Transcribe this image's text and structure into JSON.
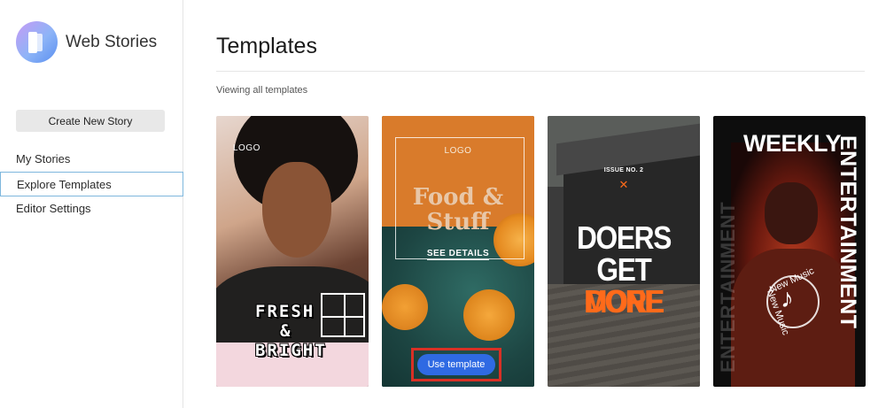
{
  "app": {
    "name": "Web Stories"
  },
  "sidebar": {
    "create_button": "Create New Story",
    "nav": [
      {
        "label": "My Stories",
        "active": false
      },
      {
        "label": "Explore Templates",
        "active": true
      },
      {
        "label": "Editor Settings",
        "active": false
      }
    ]
  },
  "main": {
    "title": "Templates",
    "subtitle": "Viewing all templates"
  },
  "templates": [
    {
      "logo": "LOGO",
      "lines": [
        "FRESH",
        "&",
        "BRIGHT"
      ]
    },
    {
      "logo": "LOGO",
      "lines": [
        "Food &",
        "Stuff"
      ],
      "link": "SEE DETAILS",
      "action": "Use template",
      "highlighted": true,
      "highlight_color": "#d93025",
      "button_color": "#2f6ae3"
    },
    {
      "issue": "ISSUE NO. 2",
      "mark": "✕",
      "line1": "DOERS",
      "line2_white": "GET",
      "line2_orange": "MORE",
      "line3": "DONE",
      "accent": "#ff6a1a"
    },
    {
      "title": "WEEKLY",
      "vertical": "ENTERTAINMENT",
      "music": "New Music"
    }
  ],
  "colors": {
    "active_nav_border": "#7eb7dd",
    "brand_gradient": [
      "#c69bf5",
      "#5a8ff0"
    ]
  }
}
